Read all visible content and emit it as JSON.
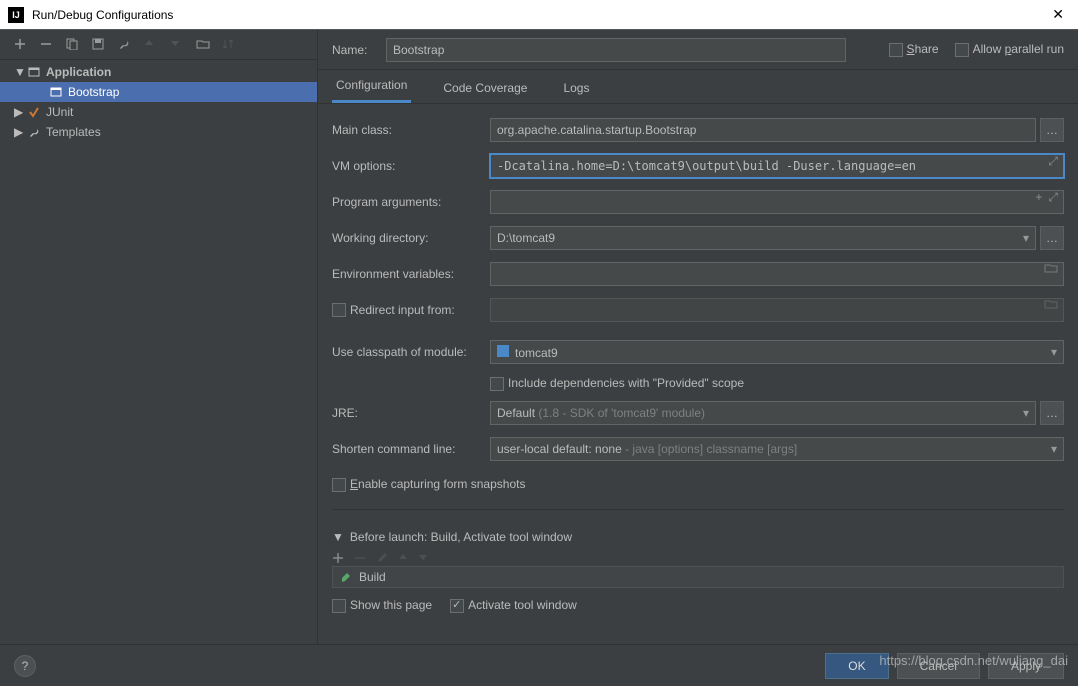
{
  "window": {
    "title": "Run/Debug Configurations"
  },
  "sidebar": {
    "items": [
      {
        "label": "Application",
        "expanded": true,
        "bold": true
      },
      {
        "label": "Bootstrap",
        "child": true,
        "selected": true
      },
      {
        "label": "JUnit"
      },
      {
        "label": "Templates"
      }
    ]
  },
  "header": {
    "name_label": "Name:",
    "name_value": "Bootstrap",
    "share_label": "Share",
    "parallel_label": "Allow parallel run"
  },
  "tabs": [
    {
      "label": "Configuration",
      "active": true
    },
    {
      "label": "Code Coverage"
    },
    {
      "label": "Logs"
    }
  ],
  "form": {
    "main_class": {
      "label": "Main class:",
      "value": "org.apache.catalina.startup.Bootstrap"
    },
    "vm_options": {
      "label": "VM options:",
      "value": "-Dcatalina.home=D:\\tomcat9\\output\\build -Duser.language=en"
    },
    "program_args": {
      "label": "Program arguments:",
      "value": ""
    },
    "working_dir": {
      "label": "Working directory:",
      "value": "D:\\tomcat9"
    },
    "env_vars": {
      "label": "Environment variables:",
      "value": ""
    },
    "redirect": {
      "label": "Redirect input from:",
      "checked": false,
      "value": ""
    },
    "classpath": {
      "label": "Use classpath of module:",
      "value": "tomcat9"
    },
    "include_provided": {
      "label": "Include dependencies with \"Provided\" scope",
      "checked": false
    },
    "jre": {
      "label": "JRE:",
      "value": "Default",
      "hint": "(1.8 - SDK of 'tomcat9' module)"
    },
    "shorten": {
      "label": "Shorten command line:",
      "value": "user-local default: none",
      "hint": "- java [options] classname [args]"
    },
    "snapshots": {
      "label": "Enable capturing form snapshots",
      "checked": false
    }
  },
  "before_launch": {
    "header": "Before launch: Build, Activate tool window",
    "item": "Build",
    "show_page": {
      "label": "Show this page",
      "checked": false
    },
    "activate": {
      "label": "Activate tool window",
      "checked": true
    }
  },
  "buttons": {
    "ok": "OK",
    "cancel": "Cancel",
    "apply": "Apply"
  },
  "watermark": "https://blog.csdn.net/wuliang_dai"
}
